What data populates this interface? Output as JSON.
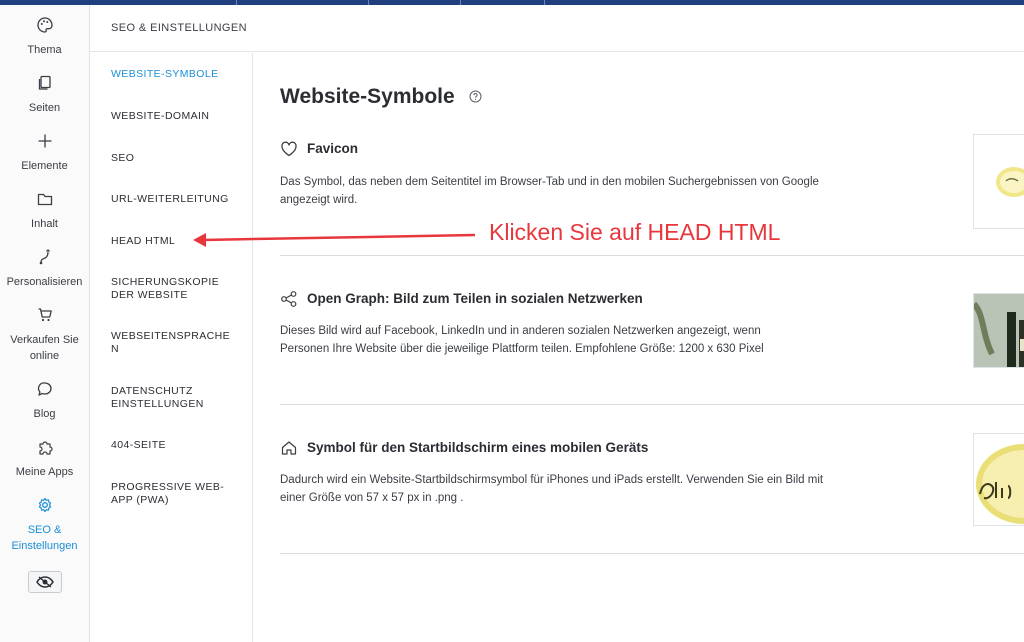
{
  "rail": {
    "items": [
      {
        "label": "Thema",
        "icon": "palette-icon"
      },
      {
        "label": "Seiten",
        "icon": "pages-icon"
      },
      {
        "label": "Elemente",
        "icon": "plus-icon"
      },
      {
        "label": "Inhalt",
        "icon": "folder-icon"
      },
      {
        "label": "Personalisieren",
        "icon": "personalize-icon"
      },
      {
        "label": "Verkaufen Sie online",
        "icon": "cart-icon"
      },
      {
        "label": "Blog",
        "icon": "chat-bubble-icon"
      },
      {
        "label": "Meine Apps",
        "icon": "puzzle-icon"
      },
      {
        "label": "SEO & Einstellungen",
        "icon": "gear-icon"
      }
    ],
    "preview_icon": "eye-icon"
  },
  "submenu": {
    "header": "SEO & EINSTELLUNGEN",
    "items": [
      "WEBSITE-SYMBOLE",
      "WEBSITE-DOMAIN",
      "SEO",
      "URL-WEITERLEITUNG",
      "HEAD HTML",
      "SICHERUNGSKOPIE DER WEBSITE",
      "WEBSEITENSPRACHE N",
      "DATENSCHUTZ EINSTELLUNGEN",
      "404-SEITE",
      "PROGRESSIVE WEB-APP (PWA)"
    ],
    "active_index": 0
  },
  "main": {
    "title": "Website-Symbole",
    "sections": [
      {
        "title": "Favicon",
        "icon": "heart-icon",
        "description": "Das Symbol, das neben dem Seitentitel im Browser-Tab und in den mobilen Suchergebnissen von Google angezeigt wird."
      },
      {
        "title": "Open Graph: Bild zum Teilen in sozialen Netzwerken",
        "icon": "share-icon",
        "description": "Dieses Bild wird auf Facebook, LinkedIn und in anderen sozialen Netzwerken angezeigt, wenn Personen Ihre Website über die jeweilige Plattform teilen. Empfohlene Größe: 1200 x 630 Pixel"
      },
      {
        "title": "Symbol für den Startbildschirm eines mobilen Geräts",
        "icon": "home-icon",
        "description": "Dadurch wird ein Website-Startbildschirmsymbol für iPhones und iPads erstellt. Verwenden Sie ein Bild mit einer Größe von 57 x 57 px in .png ."
      }
    ]
  },
  "annotation": {
    "text": "Klicken Sie auf HEAD HTML",
    "color": "#e8373c"
  },
  "colors": {
    "accent": "#1a8fd6",
    "topbar": "#1f3f7f"
  }
}
